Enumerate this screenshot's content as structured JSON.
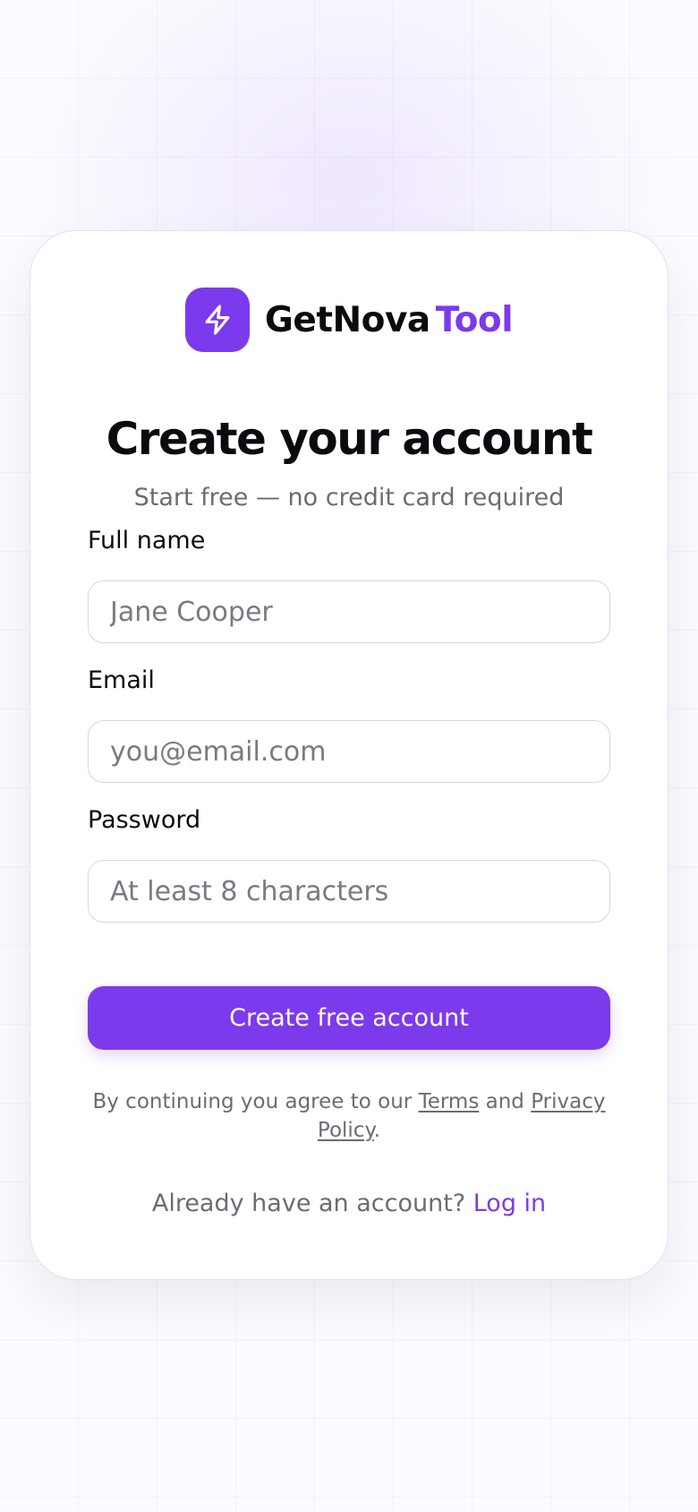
{
  "brand": {
    "name": "GetNova",
    "accent": "Tool",
    "icon": "lightning-bolt-icon",
    "color": "#7c3aed"
  },
  "heading": {
    "title": "Create your account",
    "subtitle": "Start free — no credit card required"
  },
  "form": {
    "full_name": {
      "label": "Full name",
      "placeholder": "Jane Cooper",
      "value": ""
    },
    "email": {
      "label": "Email",
      "placeholder": "you@email.com",
      "value": ""
    },
    "password": {
      "label": "Password",
      "placeholder": "At least 8 characters",
      "value": ""
    },
    "submit_label": "Create free account"
  },
  "legal": {
    "prefix": "By continuing you agree to our ",
    "terms_link": "Terms",
    "joiner": " and ",
    "privacy_link": "Privacy Policy",
    "suffix": "."
  },
  "footer": {
    "prompt": "Already have an account? ",
    "login_link": "Log in"
  }
}
